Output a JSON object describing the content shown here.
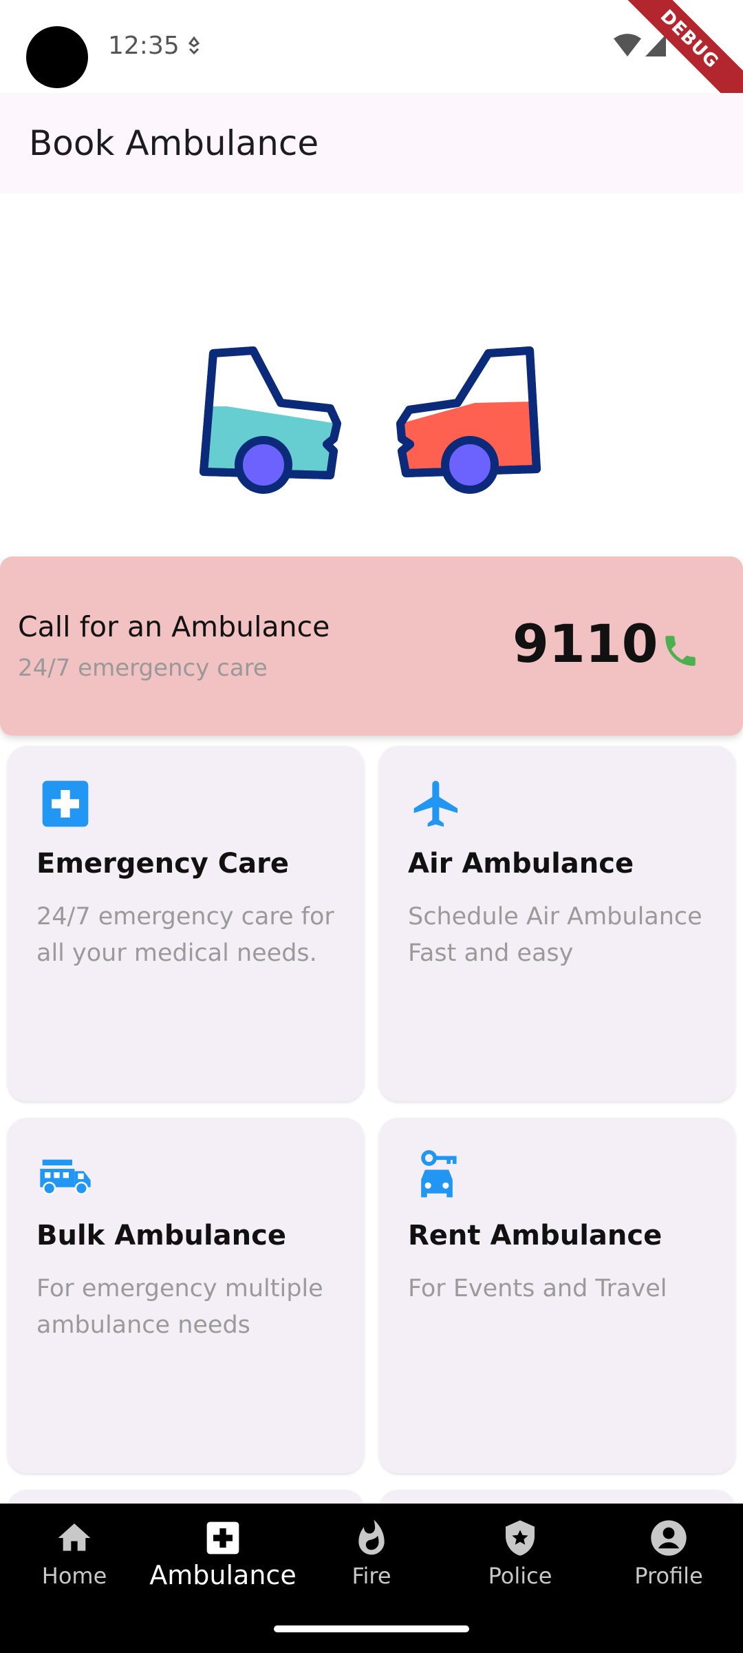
{
  "status": {
    "time": "12:35",
    "debug": "DEBUG"
  },
  "app_bar": {
    "title": "Book Ambulance"
  },
  "call_card": {
    "title": "Call for an Ambulance",
    "subtitle": "24/7 emergency care",
    "number": "9110",
    "phone_icon": "phone-icon"
  },
  "cards": [
    {
      "title": "Emergency Care",
      "desc": "24/7 emergency care for all your medical needs.",
      "icon": "medical-cross-icon"
    },
    {
      "title": "Air Ambulance",
      "desc": "Schedule Air Ambulance Fast and easy",
      "icon": "airplane-icon"
    },
    {
      "title": "Bulk Ambulance",
      "desc": "For emergency multiple ambulance needs",
      "icon": "fire-truck-icon"
    },
    {
      "title": "Rent Ambulance",
      "desc": "For Events and Travel",
      "icon": "car-rental-icon"
    }
  ],
  "nav": {
    "items": [
      {
        "label": "Home",
        "icon": "home-icon"
      },
      {
        "label": "Ambulance",
        "icon": "medical-cross-icon"
      },
      {
        "label": "Fire",
        "icon": "fire-icon"
      },
      {
        "label": "Police",
        "icon": "police-shield-icon"
      },
      {
        "label": "Profile",
        "icon": "profile-icon"
      }
    ],
    "active": "Ambulance"
  },
  "colors": {
    "accent_blue": "#2196f3",
    "call_card_bg": "#f2c1c1",
    "phone_green": "#4caf50",
    "card_bg": "#f4eff6",
    "car_teal": "#66cdd1",
    "car_red": "#ff6150",
    "car_outline": "#0b2a7a",
    "wheel": "#6c63ff"
  }
}
